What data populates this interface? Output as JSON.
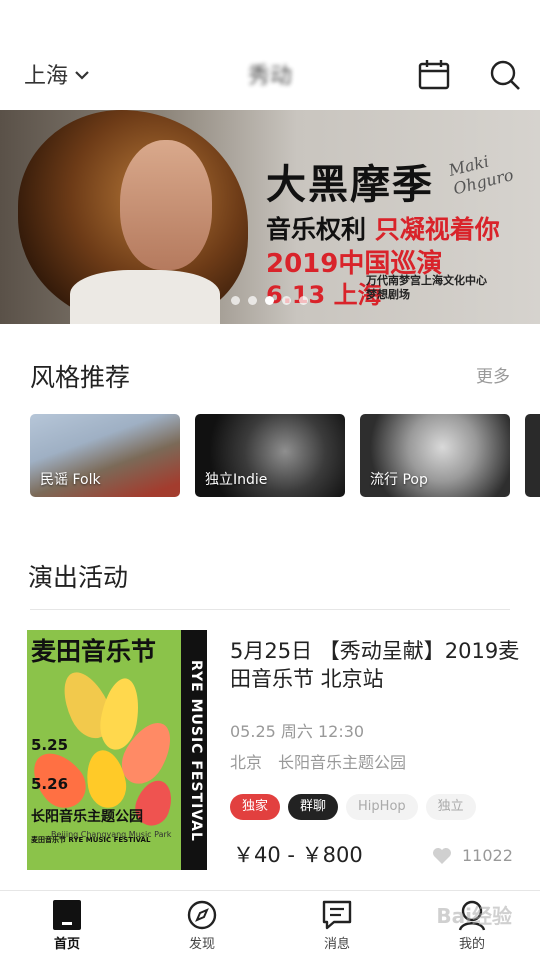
{
  "header": {
    "city": "上海",
    "app_title": "秀动"
  },
  "banner": {
    "title": "大黑摩季",
    "signature": "Maki Ohguro",
    "line2_black": "音乐权利",
    "line2_red": "只凝视着你",
    "line3": "2019中国巡演",
    "date_city": "6.13 上海",
    "venue_line1": "万代南梦宫上海文化中心",
    "venue_line2": "梦想剧场",
    "dots_total": 5,
    "dots_active": 3
  },
  "styles": {
    "title": "风格推荐",
    "more": "更多",
    "cards": [
      {
        "label": "民谣 Folk"
      },
      {
        "label": "独立Indie"
      },
      {
        "label": "流行 Pop"
      }
    ]
  },
  "events": {
    "title": "演出活动",
    "item": {
      "poster_title": "麦田音乐节",
      "poster_vertical": "RYE MUSIC FESTIVAL",
      "poster_date1": "5.25",
      "poster_date2": "5.26",
      "poster_venue": "长阳音乐主题公园",
      "poster_english": "Beijing Changyang Music Park",
      "poster_logo": "麦田音乐节 RYE MUSIC FESTIVAL",
      "title": "5月25日 【秀动呈献】2019麦田音乐节 北京站",
      "time": "05.25 周六 12:30",
      "city": "北京",
      "venue": "长阳音乐主题公园",
      "tags": [
        "独家",
        "群聊",
        "HipHop",
        "独立"
      ],
      "price": "￥40 - ￥800",
      "likes": "11022"
    }
  },
  "nav": {
    "items": [
      {
        "label": "首页"
      },
      {
        "label": "发现"
      },
      {
        "label": "消息"
      },
      {
        "label": "我的"
      }
    ]
  },
  "watermark": "Bai经验"
}
